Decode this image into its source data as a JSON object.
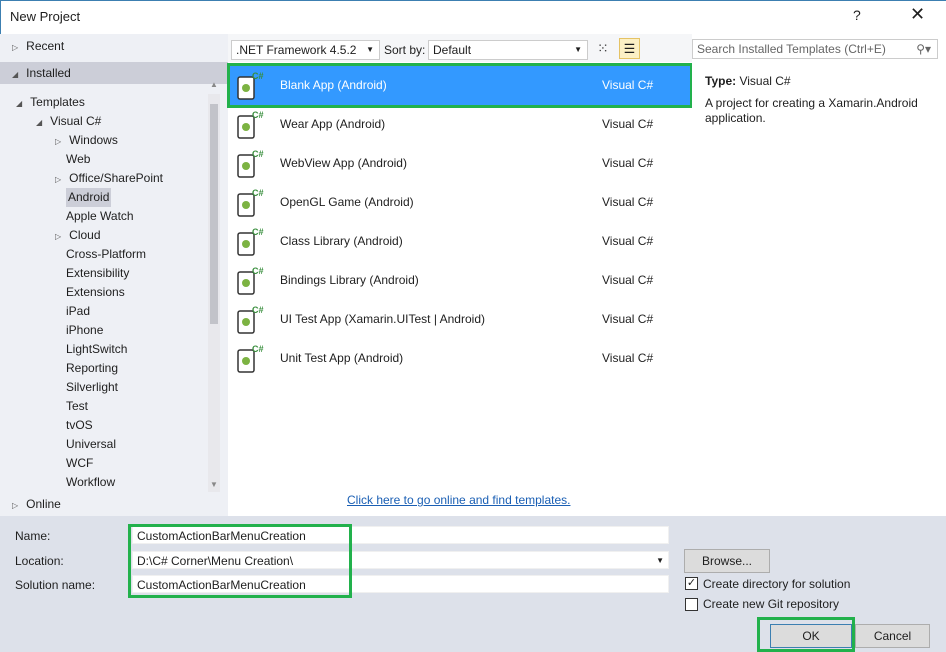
{
  "window": {
    "title": "New Project",
    "help": "?",
    "close": "✕"
  },
  "left": {
    "recent": "Recent",
    "installed": "Installed",
    "online": "Online",
    "tree": [
      {
        "label": "Templates",
        "level": 0,
        "arrow": "◢"
      },
      {
        "label": "Visual C#",
        "level": 1,
        "arrow": "◢"
      },
      {
        "label": "Windows",
        "level": 2,
        "arrow": "▷"
      },
      {
        "label": "Web",
        "level": 2
      },
      {
        "label": "Office/SharePoint",
        "level": 2,
        "arrow": "▷"
      },
      {
        "label": "Android",
        "level": 2,
        "selected": true
      },
      {
        "label": "Apple Watch",
        "level": 2
      },
      {
        "label": "Cloud",
        "level": 2,
        "arrow": "▷"
      },
      {
        "label": "Cross-Platform",
        "level": 2
      },
      {
        "label": "Extensibility",
        "level": 2
      },
      {
        "label": "Extensions",
        "level": 2
      },
      {
        "label": "iPad",
        "level": 2
      },
      {
        "label": "iPhone",
        "level": 2
      },
      {
        "label": "LightSwitch",
        "level": 2
      },
      {
        "label": "Reporting",
        "level": 2
      },
      {
        "label": "Silverlight",
        "level": 2
      },
      {
        "label": "Test",
        "level": 2
      },
      {
        "label": "tvOS",
        "level": 2
      },
      {
        "label": "Universal",
        "level": 2
      },
      {
        "label": "WCF",
        "level": 2
      },
      {
        "label": "Workflow",
        "level": 2
      }
    ]
  },
  "toolbar": {
    "framework": ".NET Framework 4.5.2",
    "sort_label": "Sort by:",
    "sort_value": "Default",
    "search_placeholder": "Search Installed Templates (Ctrl+E)"
  },
  "templates": [
    {
      "name": "Blank App (Android)",
      "lang": "Visual C#",
      "selected": true
    },
    {
      "name": "Wear App (Android)",
      "lang": "Visual C#"
    },
    {
      "name": "WebView App (Android)",
      "lang": "Visual C#"
    },
    {
      "name": "OpenGL Game (Android)",
      "lang": "Visual C#"
    },
    {
      "name": "Class Library (Android)",
      "lang": "Visual C#"
    },
    {
      "name": "Bindings Library (Android)",
      "lang": "Visual C#"
    },
    {
      "name": "UI Test App (Xamarin.UITest | Android)",
      "lang": "Visual C#"
    },
    {
      "name": "Unit Test App (Android)",
      "lang": "Visual C#"
    }
  ],
  "online_link": "Click here to go online and find templates.",
  "details": {
    "type_label": "Type:",
    "type_value": "Visual C#",
    "description": "A project for creating a Xamarin.Android application."
  },
  "form": {
    "name_label": "Name:",
    "name_value": "CustomActionBarMenuCreation",
    "location_label": "Location:",
    "location_value": "D:\\C# Corner\\Menu Creation\\",
    "solution_label": "Solution name:",
    "solution_value": "CustomActionBarMenuCreation",
    "browse": "Browse...",
    "create_dir": "Create directory for solution",
    "create_git": "Create new Git repository",
    "ok": "OK",
    "cancel": "Cancel"
  },
  "colors": {
    "selection": "#3399ff",
    "highlight": "#22b14c"
  }
}
